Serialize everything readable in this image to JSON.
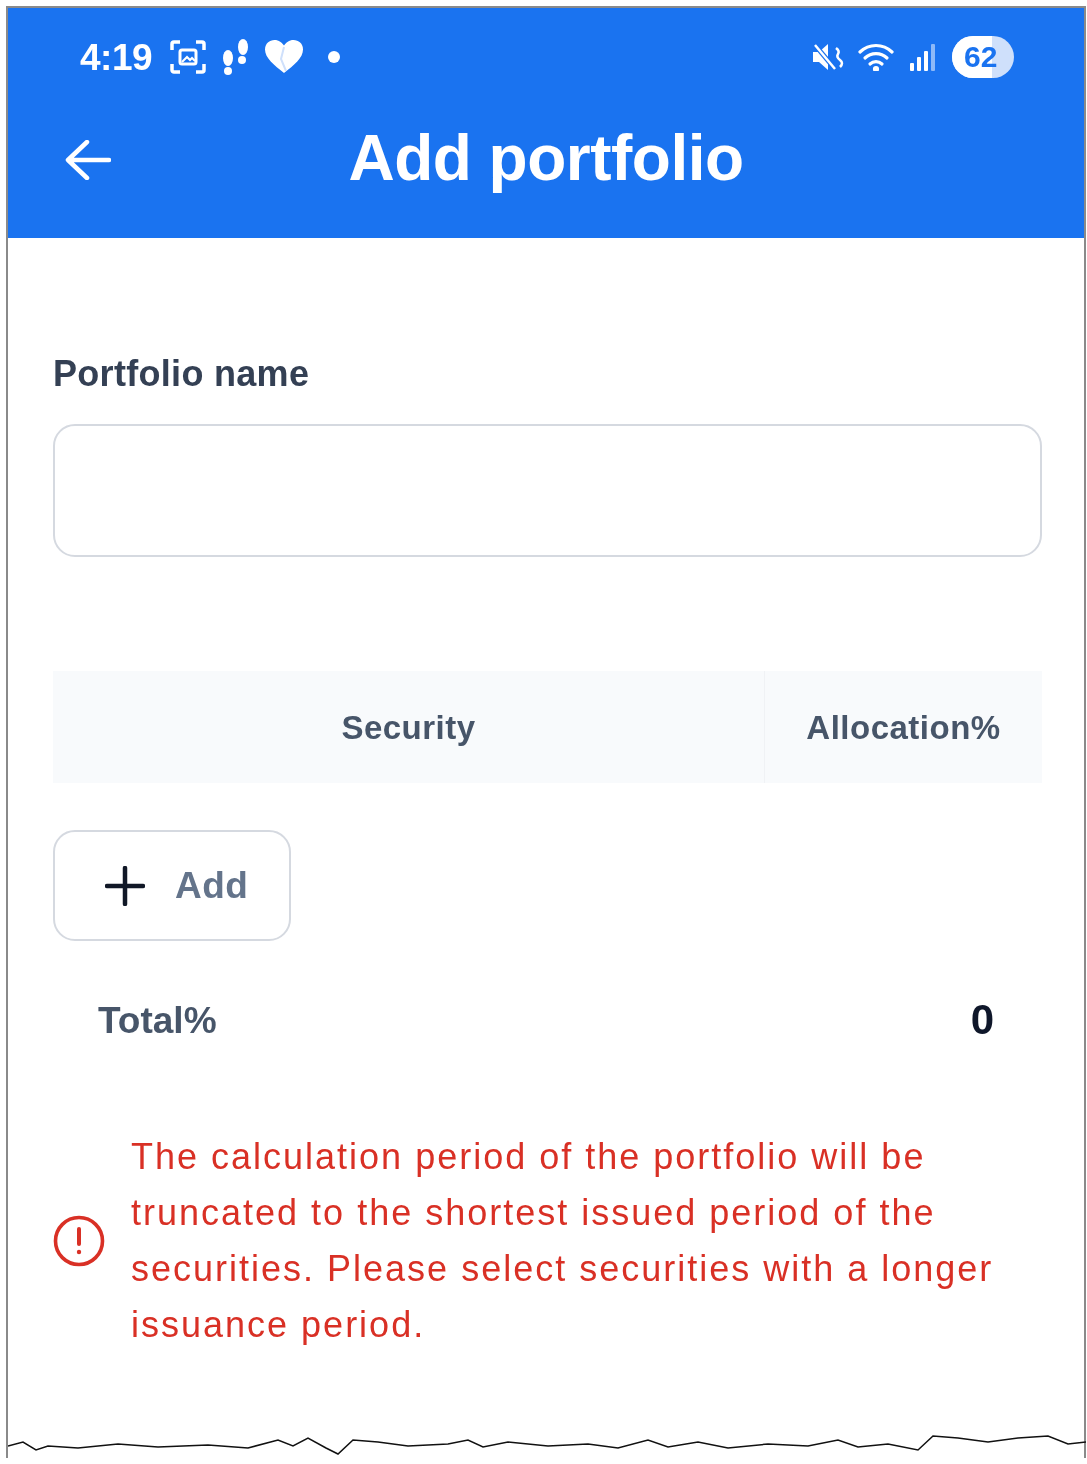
{
  "status_bar": {
    "time": "4:19",
    "battery": "62"
  },
  "header": {
    "title": "Add portfolio"
  },
  "portfolio_name": {
    "label": "Portfolio name"
  },
  "table": {
    "columns": [
      "Security",
      "Allocation%"
    ]
  },
  "add_button": {
    "label": "Add"
  },
  "total": {
    "label": "Total%",
    "value": "0"
  },
  "warning": {
    "text": "The calculation period of the portfolio will be truncated to the shortest issued period of the securities. Please select securities with a longer issuance period."
  }
}
